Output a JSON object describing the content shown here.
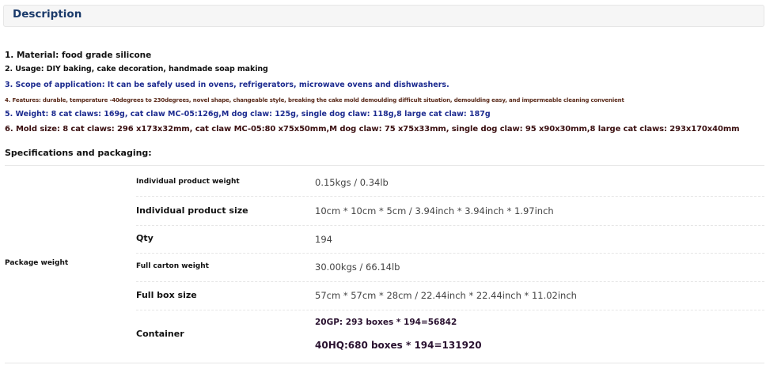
{
  "header": {
    "title": "Description"
  },
  "description_lines": [
    "1. Material: food grade silicone",
    "2. Usage: DIY baking, cake decoration, handmade soap making",
    "3. Scope of application: It can be safely used in ovens, refrigerators, microwave ovens and dishwashers.",
    "4. Features: durable, temperature -40degrees to 230degrees, novel shape, changeable style, breaking the cake mold demoulding difficult situation, demoulding easy, and impermeable cleaning convenient",
    "5. Weight: 8 cat claws: 169g, cat claw MC-05:126g,M dog claw: 125g, single dog claw: 118g,8 large cat claw: 187g",
    "6. Mold size: 8 cat claws: 296 x173x32mm, cat claw MC-05:80 x75x50mm,M dog claw: 75 x75x33mm, single dog claw: 95 x90x30mm,8 large cat claws: 293x170x40mm"
  ],
  "specs": {
    "title": "Specifications and packaging:",
    "package_label": "Package weight",
    "rows": [
      {
        "label": "Individual product weight",
        "value": "0.15kgs / 0.34lb"
      },
      {
        "label": "Individual product size",
        "value": "10cm * 10cm * 5cm / 3.94inch * 3.94inch * 1.97inch"
      },
      {
        "label": "Qty",
        "value": "194"
      },
      {
        "label": "Full carton weight",
        "value": "30.00kgs / 66.14lb"
      },
      {
        "label": "Full box size",
        "value": "57cm * 57cm * 28cm / 22.44inch * 22.44inch * 11.02inch"
      }
    ],
    "container": {
      "label": "Container",
      "values": [
        "20GP: 293 boxes * 194=56842",
        "40HQ:680 boxes * 194=131920"
      ]
    }
  }
}
